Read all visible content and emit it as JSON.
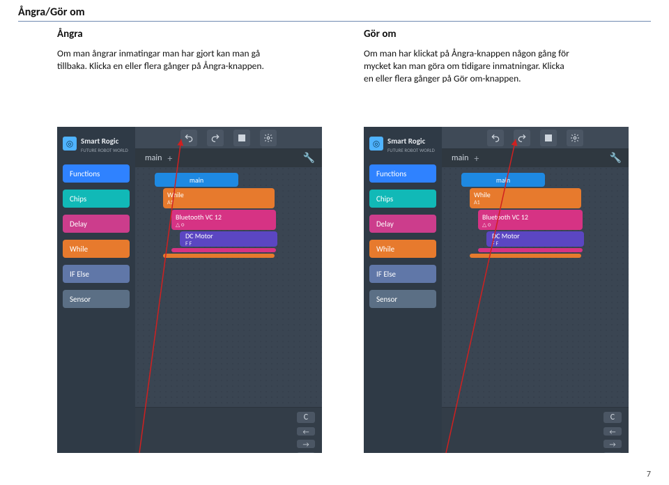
{
  "section_title": "Ångra/Gör om",
  "page_number": "7",
  "columns": {
    "left": {
      "heading": "Ångra",
      "body": "Om man ångrar inmatingar man har gjort kan man gå tillbaka.\nKlicka en eller flera gånger på Ångra-knappen."
    },
    "right": {
      "heading": "Gör om",
      "body": "Om man har klickat på Ångra-knappen någon gång för mycket kan man göra om tidigare inmatningar.\nKlicka en eller flera gånger på Gör om-knappen."
    }
  },
  "app": {
    "brand_main": "Smart Rogic",
    "brand_sub": "FUTURE ROBOT WORLD",
    "tab_label": "main",
    "top_icons": [
      "undo",
      "redo",
      "stop",
      "settings"
    ],
    "sidebar_items": [
      {
        "label": "Functions",
        "color": "c-blue"
      },
      {
        "label": "Chips",
        "color": "c-teal"
      },
      {
        "label": "Delay",
        "color": "c-pink"
      },
      {
        "label": "While",
        "color": "c-orange"
      },
      {
        "label": "IF Else",
        "color": "c-steel"
      },
      {
        "label": "Sensor",
        "color": "c-slate"
      }
    ],
    "blocks": {
      "main": "main",
      "while": "While",
      "while_sub": "A1",
      "bluetooth": "Bluetooth VC 12",
      "bluetooth_sub": "△ ○",
      "motor": "DC Motor",
      "motor_sub": "F   F"
    },
    "bottom_controls": [
      "C",
      "←",
      "→",
      "🗑"
    ]
  }
}
